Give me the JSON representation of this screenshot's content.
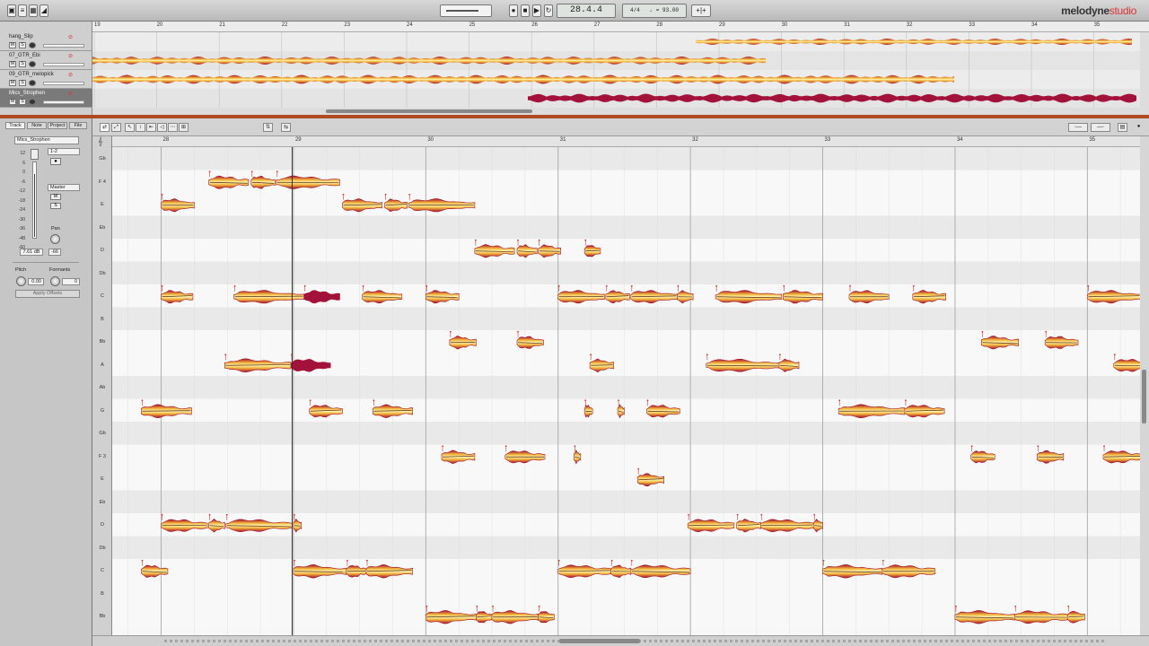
{
  "toolbar": {
    "position": "28.4.4",
    "time_signature": "4/4",
    "tempo": "93.00",
    "tempo_prefix": "♩ =",
    "brand_main": "melodyne",
    "brand_sub": "studio",
    "record_icon": "record-icon",
    "stop_icon": "stop-icon",
    "play_icon": "play-icon",
    "loop_icon": "loop-icon"
  },
  "arrangement": {
    "ruler": [
      "19",
      "20",
      "21",
      "22",
      "23",
      "24",
      "25",
      "26",
      "27",
      "28",
      "29",
      "30",
      "31",
      "32",
      "33",
      "34",
      "35"
    ],
    "tracks": [
      {
        "name": "hang_Slip",
        "selected": false
      },
      {
        "name": "07_GTR_Ebi",
        "selected": false
      },
      {
        "name": "09_GTR_melopick",
        "selected": false
      },
      {
        "name": "Mics_Strophen",
        "selected": true
      }
    ],
    "mute_label": "M",
    "solo_label": "S"
  },
  "inspector": {
    "tabs": [
      "Track",
      "Note",
      "Project",
      "File"
    ],
    "active_tab": "Track",
    "track_name": "Mics_Strophen",
    "input": "1-2",
    "output": "Master",
    "meter_scale": [
      "12",
      "6",
      "0",
      "-6",
      "-12",
      "-18",
      "-24",
      "-30",
      "-36",
      "-48",
      "-60"
    ],
    "volume_value": "7.61 dB",
    "peak_value": "-66",
    "pan_label": "Pan",
    "pitch_label": "Pitch",
    "formants_label": "Formants",
    "pitch_value": "0.00",
    "formants_value": "0",
    "apply_label": "Apply Offsets",
    "mute_label": "M",
    "solo_label": "S"
  },
  "editor": {
    "ruler": [
      "28",
      "29",
      "30",
      "31",
      "32",
      "33",
      "34",
      "35"
    ],
    "pitch_labels": [
      "Gb",
      "F 4",
      "E",
      "Eb",
      "D",
      "Db",
      "C",
      "B",
      "Bb",
      "A",
      "Ab",
      "G",
      "Gb",
      "F 3",
      "E",
      "Eb",
      "D",
      "Db",
      "C",
      "B",
      "Bb"
    ]
  },
  "colors": {
    "blob_inner": "#fff6b0",
    "blob_mid": "#f2b23a",
    "blob_outer": "#a3122e",
    "selected_blob": "#a3123a",
    "separator": "#b04a20",
    "accent_red": "#d33333"
  },
  "notes": [
    {
      "row": 2,
      "bar": 28.0,
      "len": 0.25
    },
    {
      "row": 1,
      "bar": 28.36,
      "len": 0.3
    },
    {
      "row": 1,
      "bar": 28.68,
      "len": 0.18
    },
    {
      "row": 1,
      "bar": 28.87,
      "len": 0.48
    },
    {
      "row": 2,
      "bar": 29.37,
      "len": 0.3
    },
    {
      "row": 2,
      "bar": 29.69,
      "len": 0.17
    },
    {
      "row": 2,
      "bar": 29.87,
      "len": 0.5
    },
    {
      "row": 4,
      "bar": 30.37,
      "len": 0.3
    },
    {
      "row": 4,
      "bar": 30.69,
      "len": 0.15
    },
    {
      "row": 4,
      "bar": 30.85,
      "len": 0.17
    },
    {
      "row": 4,
      "bar": 31.2,
      "len": 0.12
    },
    {
      "row": 6,
      "bar": 28.0,
      "len": 0.24
    },
    {
      "row": 6,
      "bar": 28.55,
      "len": 0.53
    },
    {
      "row": 6,
      "bar": 29.08,
      "len": 0.27,
      "selected": true
    },
    {
      "row": 6,
      "bar": 29.52,
      "len": 0.3
    },
    {
      "row": 6,
      "bar": 30.0,
      "len": 0.25
    },
    {
      "row": 6,
      "bar": 31.0,
      "len": 0.35
    },
    {
      "row": 6,
      "bar": 31.36,
      "len": 0.18
    },
    {
      "row": 6,
      "bar": 31.55,
      "len": 0.35
    },
    {
      "row": 6,
      "bar": 31.9,
      "len": 0.12
    },
    {
      "row": 6,
      "bar": 32.19,
      "len": 0.5
    },
    {
      "row": 6,
      "bar": 32.7,
      "len": 0.3
    },
    {
      "row": 6,
      "bar": 33.2,
      "len": 0.3
    },
    {
      "row": 6,
      "bar": 33.68,
      "len": 0.25
    },
    {
      "row": 6,
      "bar": 35.0,
      "len": 0.4
    },
    {
      "row": 8,
      "bar": 30.18,
      "len": 0.2
    },
    {
      "row": 8,
      "bar": 30.69,
      "len": 0.2
    },
    {
      "row": 8,
      "bar": 34.2,
      "len": 0.28
    },
    {
      "row": 8,
      "bar": 34.68,
      "len": 0.25
    },
    {
      "row": 9,
      "bar": 28.48,
      "len": 0.5
    },
    {
      "row": 9,
      "bar": 28.98,
      "len": 0.3,
      "selected": true
    },
    {
      "row": 9,
      "bar": 31.24,
      "len": 0.18
    },
    {
      "row": 9,
      "bar": 32.12,
      "len": 0.55
    },
    {
      "row": 9,
      "bar": 32.67,
      "len": 0.15
    },
    {
      "row": 9,
      "bar": 35.2,
      "len": 0.3
    },
    {
      "row": 11,
      "bar": 27.85,
      "len": 0.38
    },
    {
      "row": 11,
      "bar": 29.12,
      "len": 0.25
    },
    {
      "row": 11,
      "bar": 29.6,
      "len": 0.3
    },
    {
      "row": 11,
      "bar": 31.2,
      "len": 0.06
    },
    {
      "row": 11,
      "bar": 31.45,
      "len": 0.05
    },
    {
      "row": 11,
      "bar": 31.67,
      "len": 0.25
    },
    {
      "row": 11,
      "bar": 33.12,
      "len": 0.5
    },
    {
      "row": 11,
      "bar": 33.62,
      "len": 0.3
    },
    {
      "row": 13,
      "bar": 30.12,
      "len": 0.25
    },
    {
      "row": 13,
      "bar": 30.6,
      "len": 0.3
    },
    {
      "row": 13,
      "bar": 31.12,
      "len": 0.05
    },
    {
      "row": 13,
      "bar": 34.12,
      "len": 0.18
    },
    {
      "row": 13,
      "bar": 34.62,
      "len": 0.2
    },
    {
      "row": 13,
      "bar": 35.12,
      "len": 0.3
    },
    {
      "row": 14,
      "bar": 31.6,
      "len": 0.2
    },
    {
      "row": 16,
      "bar": 28.0,
      "len": 0.35
    },
    {
      "row": 16,
      "bar": 28.36,
      "len": 0.12
    },
    {
      "row": 16,
      "bar": 28.49,
      "len": 0.5
    },
    {
      "row": 16,
      "bar": 29.0,
      "len": 0.06
    },
    {
      "row": 16,
      "bar": 31.98,
      "len": 0.35
    },
    {
      "row": 16,
      "bar": 32.35,
      "len": 0.18
    },
    {
      "row": 16,
      "bar": 32.53,
      "len": 0.4
    },
    {
      "row": 16,
      "bar": 32.93,
      "len": 0.07
    },
    {
      "row": 18,
      "bar": 27.85,
      "len": 0.2
    },
    {
      "row": 18,
      "bar": 29.0,
      "len": 0.4
    },
    {
      "row": 18,
      "bar": 29.4,
      "len": 0.15
    },
    {
      "row": 18,
      "bar": 29.55,
      "len": 0.35
    },
    {
      "row": 18,
      "bar": 31.0,
      "len": 0.4
    },
    {
      "row": 18,
      "bar": 31.4,
      "len": 0.15
    },
    {
      "row": 18,
      "bar": 31.55,
      "len": 0.45
    },
    {
      "row": 18,
      "bar": 33.0,
      "len": 0.45
    },
    {
      "row": 18,
      "bar": 33.45,
      "len": 0.4
    },
    {
      "row": 20,
      "bar": 30.0,
      "len": 0.38
    },
    {
      "row": 20,
      "bar": 30.38,
      "len": 0.12
    },
    {
      "row": 20,
      "bar": 30.5,
      "len": 0.35
    },
    {
      "row": 20,
      "bar": 30.85,
      "len": 0.12
    },
    {
      "row": 20,
      "bar": 34.0,
      "len": 0.45
    },
    {
      "row": 20,
      "bar": 34.45,
      "len": 0.4
    },
    {
      "row": 20,
      "bar": 34.85,
      "len": 0.13
    }
  ]
}
